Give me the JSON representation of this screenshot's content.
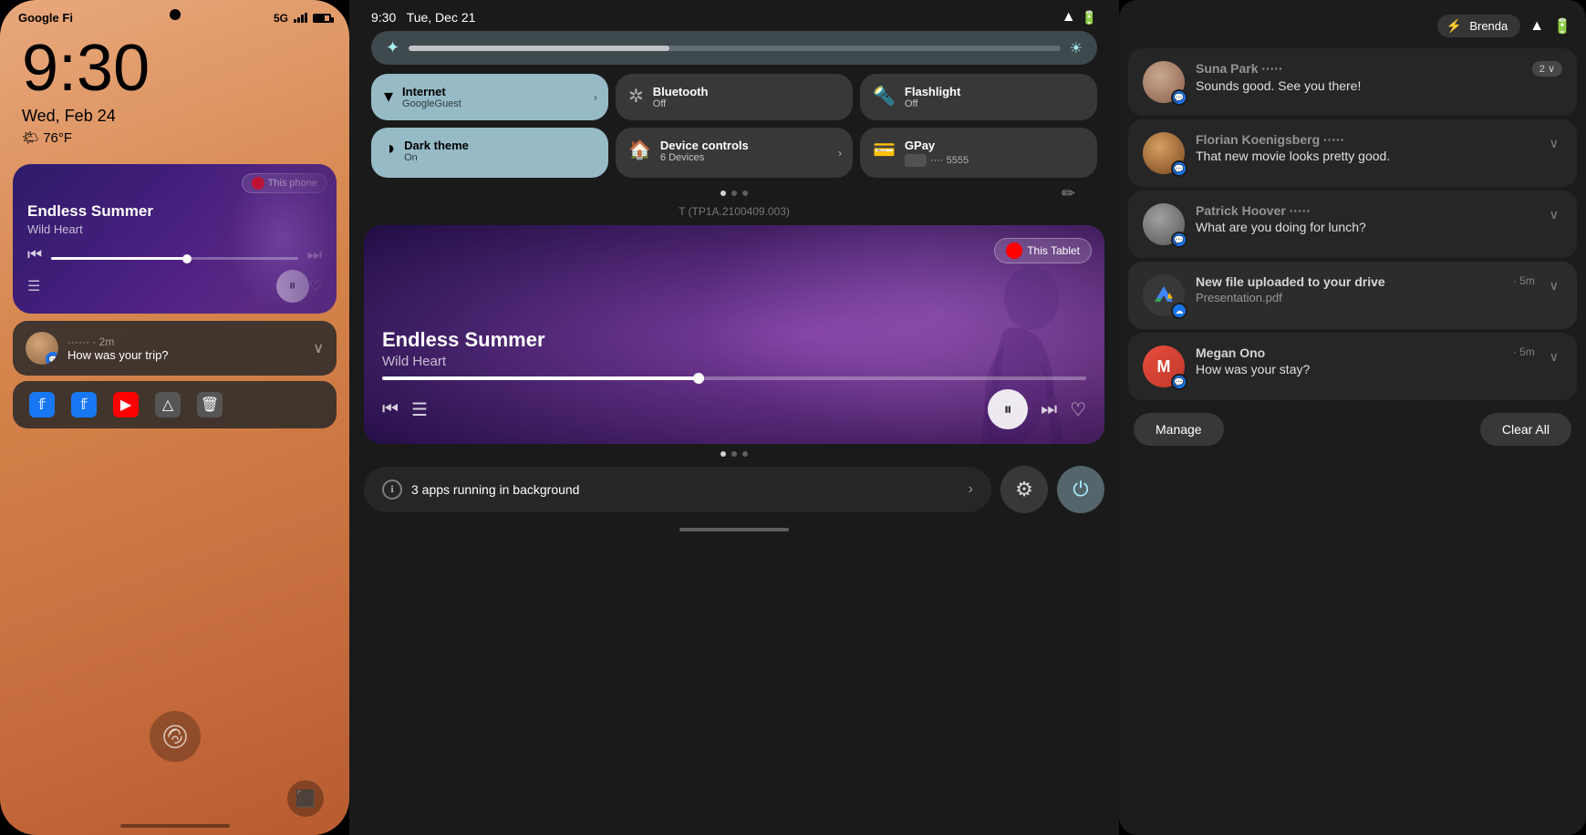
{
  "phone": {
    "carrier": "Google Fi",
    "time": "9:30",
    "network": "5G",
    "date": "Wed, Feb 24",
    "weather": "🌤 76°F",
    "music": {
      "ytm_icon": "▶",
      "badge": "This phone",
      "title": "Endless Summer",
      "subtitle": "Wild Heart",
      "pause_icon": "⏸",
      "prev_icon": "⏮",
      "next_icon": "⏭",
      "queue_icon": "☰",
      "heart_icon": "♡",
      "progress_pct": 55
    },
    "notification": {
      "sender": "······ · 2m",
      "message": "How was your trip?",
      "chevron": "∨"
    },
    "shortcuts": [
      "𝕗",
      "𝕗",
      "▶",
      "△",
      "🗑"
    ],
    "fingerprint_icon": "☁",
    "task_icon": "⬛",
    "home_indicator": true
  },
  "tablet": {
    "time": "9:30",
    "date": "Tue, Dec 21",
    "brightness": 40,
    "quick_tiles": [
      {
        "icon": "▾",
        "label": "Internet",
        "sub": "GoogleGuest",
        "active": true,
        "chevron": true
      },
      {
        "icon": "❄",
        "label": "Bluetooth",
        "sub": "Off",
        "active": false
      },
      {
        "icon": "🔦",
        "label": "Flashlight",
        "sub": "Off",
        "active": false
      },
      {
        "icon": "◑",
        "label": "Dark theme",
        "sub": "On",
        "active": true
      },
      {
        "icon": "🏠",
        "label": "Device controls",
        "sub": "6 Devices",
        "active": false,
        "chevron": true
      },
      {
        "icon": "💳",
        "label": "GPay",
        "sub": "···· 5555",
        "active": false,
        "card": true
      }
    ],
    "device_info": "T (TP1A.2100409.003)",
    "dots": [
      true,
      false,
      false
    ],
    "music": {
      "ytm_icon": "▶",
      "badge": "This Tablet",
      "title": "Endless Summer",
      "subtitle": "Wild Heart",
      "pause_icon": "⏸",
      "prev_icon": "⏮",
      "next_icon": "⏭",
      "queue_icon": "☰",
      "heart_icon": "♡",
      "progress_pct": 45
    },
    "music_dots": [
      true,
      false,
      false
    ],
    "bg_apps": {
      "icon": "ℹ",
      "text": "3 apps running in background",
      "chevron": "›"
    },
    "settings_icon": "⚙",
    "power_icon": "⏻"
  },
  "notifications": {
    "user": "Brenda",
    "items": [
      {
        "name": "Suna Park ·····",
        "message": "Sounds good. See you there!",
        "count": "2 ∨",
        "app": "messages",
        "avatar_type": "suna"
      },
      {
        "name": "Florian Koenigsberg ·····",
        "message": "That new movie looks pretty good.",
        "chevron": "∨",
        "app": "messages",
        "avatar_type": "florian"
      },
      {
        "name": "Patrick Hoover ·····",
        "message": "What are you doing for lunch?",
        "chevron": "∨",
        "app": "messages",
        "avatar_type": "patrick"
      },
      {
        "type": "drive",
        "title": "New file uploaded to your drive",
        "time": "5m",
        "subtitle": "Presentation.pdf",
        "chevron": "∨"
      },
      {
        "name": "Megan Ono",
        "time": "5m",
        "message": "How was your stay?",
        "chevron": "∨",
        "app": "messages",
        "avatar_type": "megan",
        "avatar_letter": "M"
      }
    ],
    "manage_label": "Manage",
    "clear_label": "Clear All"
  }
}
